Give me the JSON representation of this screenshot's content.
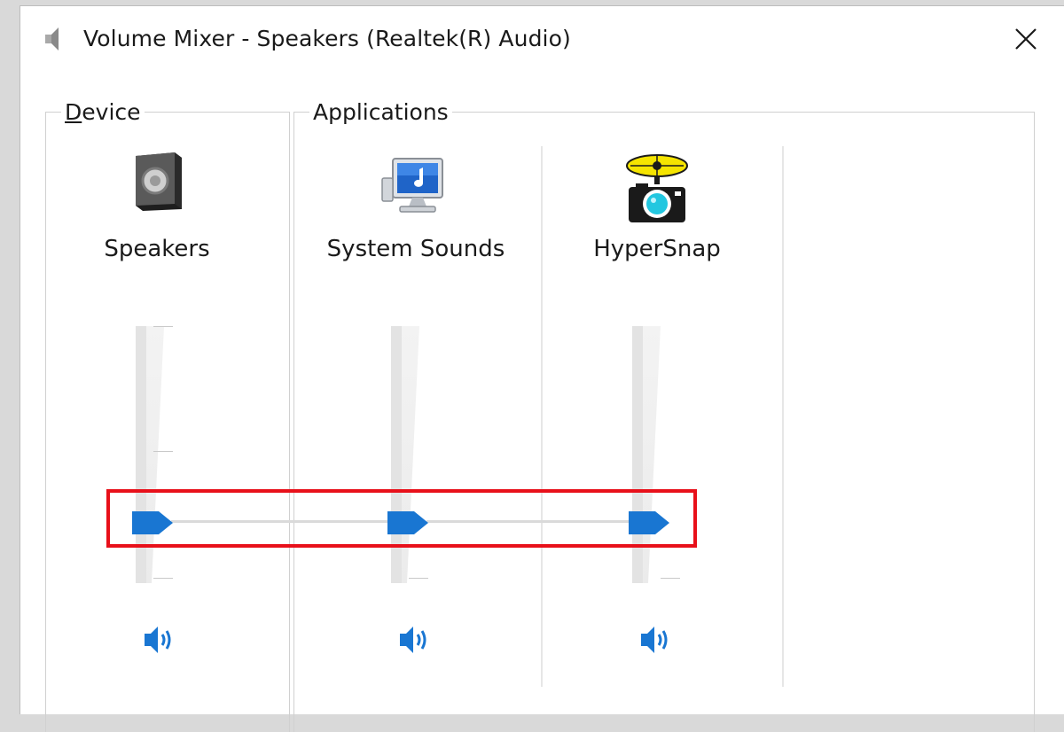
{
  "window": {
    "title": "Volume Mixer - Speakers (Realtek(R) Audio)"
  },
  "groups": {
    "device_label": "Device",
    "applications_label": "Applications"
  },
  "channels": [
    {
      "name": "Speakers",
      "icon": "speaker-icon",
      "volume_percent": 20,
      "muted": false
    },
    {
      "name": "System Sounds",
      "icon": "system-sounds-icon",
      "volume_percent": 20,
      "muted": false
    },
    {
      "name": "HyperSnap",
      "icon": "hypersnap-icon",
      "volume_percent": 20,
      "muted": false
    }
  ],
  "icons": {
    "title": "speaker-icon",
    "close": "close-icon",
    "mute": "volume-icon"
  },
  "colors": {
    "accent": "#1976d2",
    "highlight": "#e8101a"
  }
}
